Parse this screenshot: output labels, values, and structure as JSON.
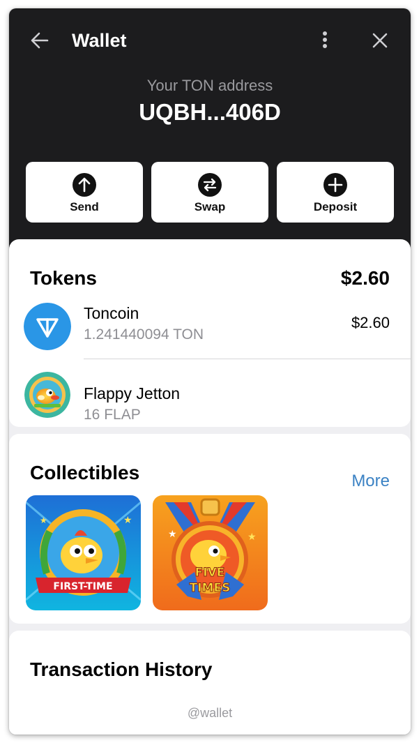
{
  "header": {
    "title": "Wallet",
    "address_label": "Your TON address",
    "address_value": "UQBH...406D"
  },
  "actions": [
    {
      "label": "Send",
      "icon": "arrow-up-circle-icon"
    },
    {
      "label": "Swap",
      "icon": "swap-arrows-icon"
    },
    {
      "label": "Deposit",
      "icon": "plus-circle-icon"
    }
  ],
  "tokens": {
    "title": "Tokens",
    "total": "$2.60",
    "items": [
      {
        "name": "Toncoin",
        "amount": "1.241440094 TON",
        "value": "$2.60",
        "icon": "toncoin-icon",
        "color": "#2a96e6"
      },
      {
        "name": "Flappy Jetton",
        "amount": "16 FLAP",
        "value": "",
        "icon": "flappy-bird-icon",
        "color": "#3cb6a0"
      }
    ]
  },
  "collectibles": {
    "title": "Collectibles",
    "more_label": "More",
    "items": [
      {
        "name": "first-time-badge",
        "text_line1": "FIRST-TIME",
        "text_line2": ""
      },
      {
        "name": "five-times-badge",
        "text_line1": "FIVE",
        "text_line2": "TIMES"
      }
    ]
  },
  "history": {
    "title": "Transaction History"
  },
  "footer": {
    "handle": "@wallet"
  },
  "colors": {
    "header_bg": "#1c1c1e",
    "page_bg": "#efeff2",
    "link": "#3b82c4",
    "ton_blue": "#2a96e6",
    "muted": "#8e8e93"
  }
}
